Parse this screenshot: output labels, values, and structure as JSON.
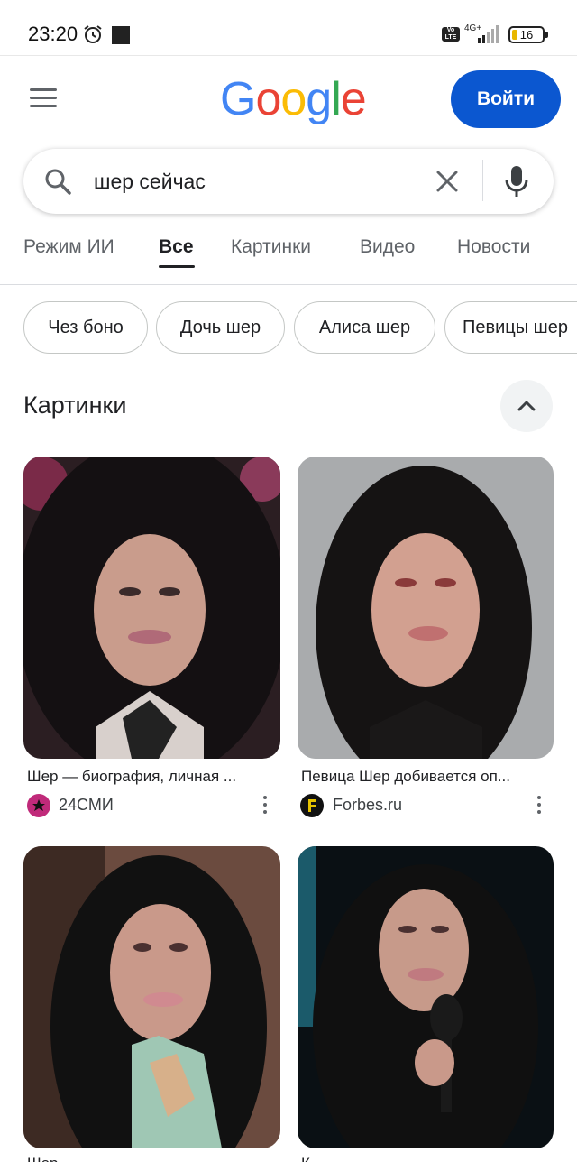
{
  "status_bar": {
    "time": "23:20",
    "network": "4G+",
    "volte": "Vo LTE",
    "battery": "16"
  },
  "header": {
    "logo": "Google",
    "login_label": "Войти"
  },
  "search": {
    "query": "шер сейчас"
  },
  "tabs": [
    {
      "label": "Режим ИИ"
    },
    {
      "label": "Все"
    },
    {
      "label": "Картинки"
    },
    {
      "label": "Видео"
    },
    {
      "label": "Новости"
    }
  ],
  "active_tab": "Все",
  "chips": [
    {
      "label": "Чез боно"
    },
    {
      "label": "Дочь шер"
    },
    {
      "label": "Алиса шер"
    },
    {
      "label": "Певицы шер"
    }
  ],
  "images_section": {
    "title": "Картинки",
    "results": [
      {
        "title": "Шер — биография, личная ...",
        "source": "24СМИ"
      },
      {
        "title": "Певица Шер добивается оп...",
        "source": "Forbes.ru"
      },
      {
        "title": "Шер ...",
        "source": ""
      },
      {
        "title": "К...",
        "source": ""
      }
    ]
  },
  "colors": {
    "accent": "#0b57d0",
    "google_blue": "#4285f4",
    "google_red": "#ea4335",
    "google_yellow": "#fbbc05",
    "google_green": "#34a853"
  }
}
